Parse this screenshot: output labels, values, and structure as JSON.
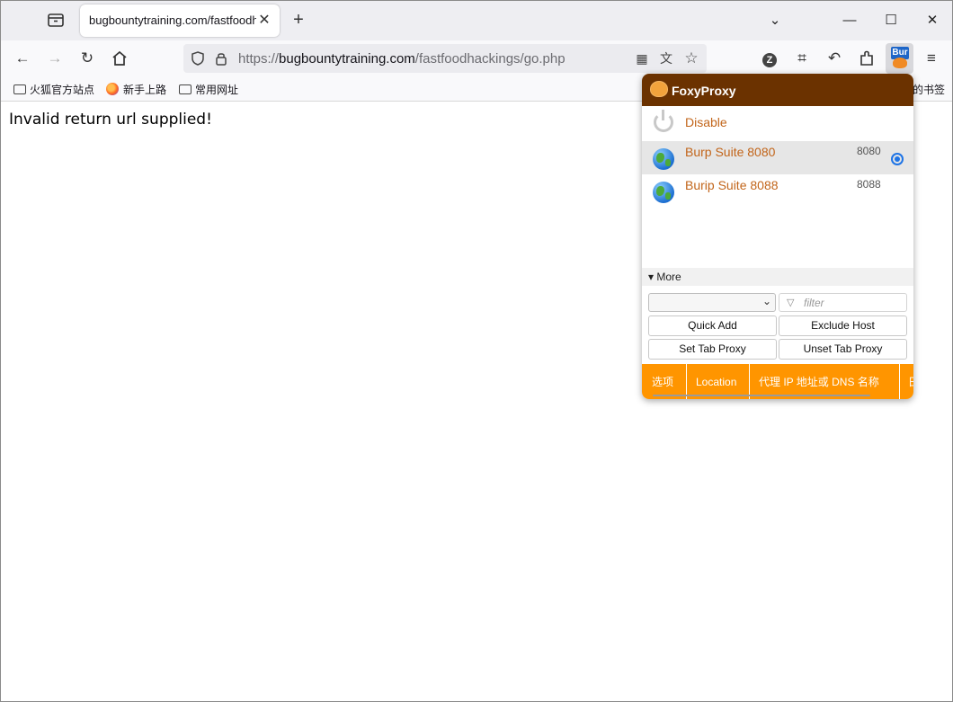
{
  "tab": {
    "title": "bugbountytraining.com/fastfoodhackings/go.php"
  },
  "url": {
    "scheme": "https://",
    "host": "bugbountytraining.com",
    "path": "/fastfoodhackings/go.php"
  },
  "bookmarks": [
    {
      "label": "火狐官方站点"
    },
    {
      "label": "新手上路"
    },
    {
      "label": "常用网址"
    }
  ],
  "bookmarks_right": "的书签",
  "page": {
    "message": "Invalid return url supplied!"
  },
  "foxyproxy": {
    "title": "FoxyProxy",
    "disable_label": "Disable",
    "proxies": [
      {
        "name": "Burp Suite 8080",
        "port": "8080",
        "selected": true
      },
      {
        "name": "Burip Suite 8088",
        "port": "8088",
        "selected": false
      }
    ],
    "more_label": "▾ More",
    "filter_placeholder": "filter",
    "buttons": {
      "quick_add": "Quick Add",
      "exclude_host": "Exclude Host",
      "set_tab_proxy": "Set Tab Proxy",
      "unset_tab_proxy": "Unset Tab Proxy"
    },
    "tabs": [
      "选项",
      "Location",
      "代理 IP 地址或 DNS 名称",
      "日"
    ]
  },
  "extension_badge": "Bur",
  "colors": {
    "header": "#6b3200",
    "accent": "#ff9500",
    "link": "#c2651a"
  }
}
